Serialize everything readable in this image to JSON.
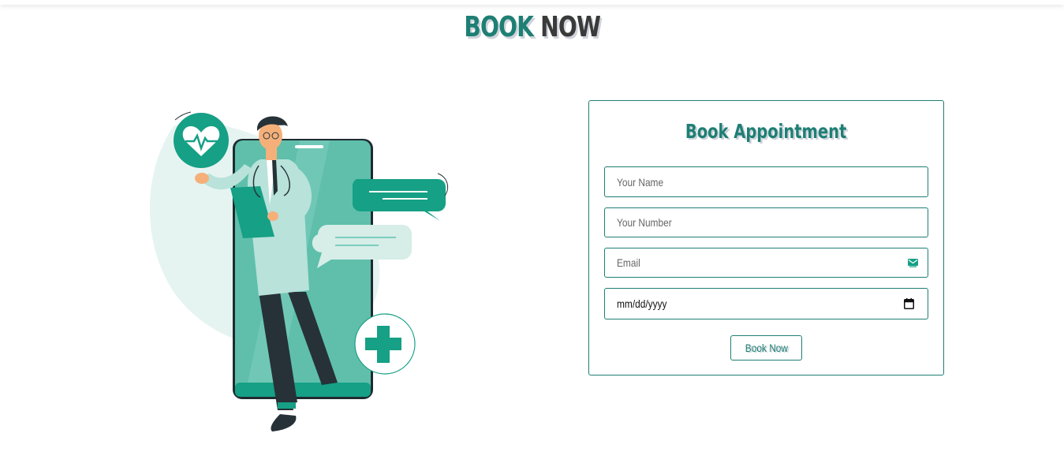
{
  "header": {
    "title_word1": "BOOK",
    "title_word2": "NOW"
  },
  "form": {
    "title": "Book Appointment",
    "name_placeholder": "Your Name",
    "number_placeholder": "Your Number",
    "email_placeholder": "Email",
    "date_value": "mm/dd/yyyy",
    "submit_label": "Book Now"
  },
  "colors": {
    "primary": "#1e7f74",
    "accent": "#16a085",
    "light": "#b8e2da",
    "dark": "#263238"
  },
  "icons": {
    "email": "mail-icon",
    "date": "calendar-icon"
  }
}
